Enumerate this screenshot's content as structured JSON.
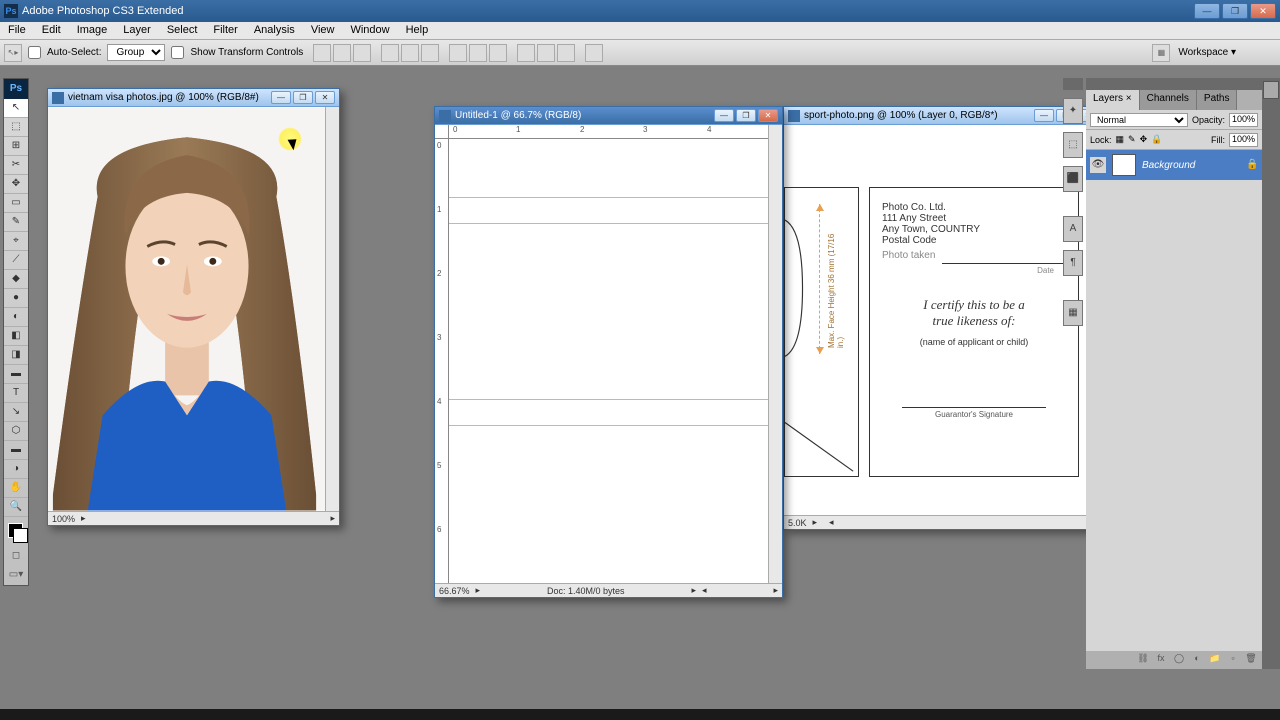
{
  "app": {
    "title": "Adobe Photoshop CS3 Extended",
    "logo_text": "Ps"
  },
  "menu": [
    "File",
    "Edit",
    "Image",
    "Layer",
    "Select",
    "Filter",
    "Analysis",
    "View",
    "Window",
    "Help"
  ],
  "optbar": {
    "auto_select_label": "Auto-Select:",
    "auto_select_value": "Group",
    "show_transform_label": "Show Transform Controls",
    "workspace_label": "Workspace ▾"
  },
  "tools": [
    "↖",
    "⬚",
    "⊞",
    "✂",
    "✥",
    "▭",
    "✎",
    "⌖",
    "⟋",
    "◆",
    "●",
    "◐",
    "◧",
    "◨",
    "▬",
    "◑",
    "✎",
    "T",
    "↘",
    "⬡",
    "✋",
    "🔍"
  ],
  "doc1": {
    "title": "vietnam visa photos.jpg @ 100% (RGB/8#)",
    "zoom": "100%"
  },
  "doc2": {
    "title": "Untitled-1 @ 66.7% (RGB/8)",
    "zoom": "66.67%",
    "doc_size": "Doc: 1.40M/0 bytes",
    "ruler_h": [
      "0",
      "1",
      "2",
      "3",
      "4"
    ],
    "ruler_v": [
      "0",
      "1",
      "2",
      "3",
      "4",
      "5",
      "6"
    ]
  },
  "doc3": {
    "title": "sport-photo.png @ 100% (Layer 0, RGB/8*)",
    "company": "Photo Co. Ltd.",
    "address1": "111 Any Street",
    "address2": "Any Town, COUNTRY",
    "postal": "Postal Code",
    "photo_taken": "Photo taken",
    "date": "Date",
    "certify1": "I certify this to be a",
    "certify2": "true likeness of:",
    "applicant": "(name of applicant or child)",
    "guarantor": "Guarantor's Signature",
    "face_label": "Max. Face Height\n36 mm (17/16 in.)",
    "status_left": "5.0K"
  },
  "layers_panel": {
    "tabs": [
      "Layers ×",
      "Channels",
      "Paths"
    ],
    "blend_mode": "Normal",
    "opacity_label": "Opacity:",
    "opacity_value": "100%",
    "lock_label": "Lock:",
    "fill_label": "Fill:",
    "fill_value": "100%",
    "layer_name": "Background"
  },
  "mid_icons": [
    "✦",
    "⬚",
    "⬛",
    "A",
    "¶",
    "▦"
  ]
}
